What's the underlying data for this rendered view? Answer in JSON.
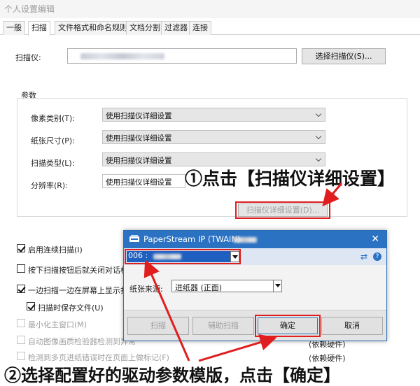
{
  "window": {
    "title": "个人设置编辑"
  },
  "tabs": [
    "一般",
    "扫描",
    "文件格式和命名规则",
    "文档分割",
    "过滤器",
    "连接"
  ],
  "scanner": {
    "label": "扫描仪:",
    "select_button": "选择扫描仪(S)..."
  },
  "params": {
    "title": "参数",
    "rows": [
      {
        "label": "像素类别(T):",
        "value": "使用扫描仪详细设置"
      },
      {
        "label": "纸张尺寸(P):",
        "value": "使用扫描仪详细设置"
      },
      {
        "label": "扫描类型(L):",
        "value": "使用扫描仪详细设置"
      },
      {
        "label": "分辨率(R):",
        "value": "使用扫描仪详细设置"
      }
    ],
    "detail_button": "扫描仪详细设置(D)..."
  },
  "checkboxes": [
    {
      "label": "启用连续扫描(I)",
      "checked": true,
      "enabled": true
    },
    {
      "label": "按下扫描按钮后就关闭对话栏(",
      "checked": false,
      "enabled": true
    },
    {
      "label": "一边扫描一边在屏幕上显示扫描",
      "checked": true,
      "enabled": true
    },
    {
      "label": "扫描时保存文件(U)",
      "checked": true,
      "enabled": true
    },
    {
      "label": "最小化主窗口(M)",
      "checked": false,
      "enabled": false
    },
    {
      "label": "自动图像画质检验器检测到异常",
      "checked": false,
      "enabled": false
    },
    {
      "label": "检测到多页进纸错误时在页面上做标记(F)",
      "checked": false,
      "enabled": false
    }
  ],
  "right_notes": [
    "(依赖硬件)",
    "(依赖硬件)"
  ],
  "dialog": {
    "title": "PaperStream IP (TWAIN)",
    "driver_value": "006 :",
    "paper_source_label": "纸张来源:",
    "paper_source_value": "进纸器 (正面)",
    "buttons": {
      "scan": "扫描",
      "assist_scan": "辅助扫描",
      "ok": "确定",
      "cancel": "取消"
    }
  },
  "annotations": {
    "step1": "①点击【扫描仪详细设置】",
    "step2": "②选择配置好的驱动参数模版，点击【确定】"
  },
  "colors": {
    "accent_red": "#e01e1e",
    "dialog_blue": "#2b72c3",
    "selection_blue": "#1f5fbf"
  }
}
